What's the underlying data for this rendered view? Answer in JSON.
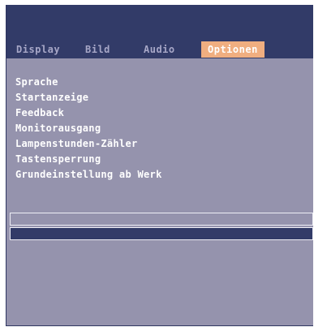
{
  "tabs": [
    {
      "label": "Display",
      "active": false
    },
    {
      "label": "Bild",
      "active": false
    },
    {
      "label": "Audio",
      "active": false
    },
    {
      "label": "Optionen",
      "active": true
    }
  ],
  "menu": {
    "items": [
      "Sprache",
      "Startanzeige",
      "Feedback",
      "Monitorausgang",
      "Lampenstunden-Zähler",
      "Tastensperrung",
      "Grundeinstellung ab Werk"
    ]
  },
  "colors": {
    "panel": "#9593ad",
    "header": "#323b68",
    "active_tab": "#f0ae80",
    "inactive_tab_text": "#a7a7c7",
    "text": "#ffffff"
  }
}
